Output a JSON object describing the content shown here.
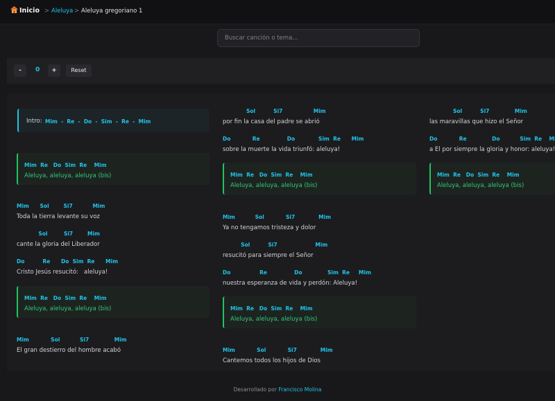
{
  "nav": {
    "home_label": "Inicio",
    "sep1": ">",
    "crumb_link": "Aleluya",
    "sep2": ">",
    "crumb_current": "Aleluya gregoriano 1"
  },
  "search": {
    "placeholder": "Buscar canción o tema..."
  },
  "controls": {
    "minus": "-",
    "value": "0",
    "plus": "+",
    "reset": "Reset"
  },
  "song": {
    "intro_label": "Intro:",
    "intro_chords": "Mim  -  Re  -  Do  -  Sim  -  Re  -  Mim",
    "chorus": {
      "chords": "Mim  Re   Do  Sim  Re    Mim",
      "lyric": "Aleluya, aleluya, aleluya (bis)"
    },
    "col1": [
      {
        "chords": "Mim      Sol        Si7           Mim",
        "lyric": "Toda la tierra levante su voz"
      },
      {
        "chords": "            Sol         Si7        Mim",
        "lyric": "cante la gloria del Liberador"
      },
      {
        "chords": "Do          Re      Do  Sim  Re      Mim",
        "lyric": "Cristo Jesús resucitó:   aleluya!"
      },
      {
        "chords": "Mim            Sol           Si7              Mim",
        "lyric": "El gran destierro del hombre acabó"
      }
    ],
    "col2": [
      {
        "chords": "             Sol          Si7                 Mim",
        "lyric": "por fin la casa del padre se abrió"
      },
      {
        "chords": "Do            Re               Do             Sim  Re      Mim",
        "lyric": "sobre la muerte la vida triunfó: aleluya!"
      },
      {
        "chords": "Mim           Sol            Si7             Mim",
        "lyric": "Ya no tengamos tristeza y dolor"
      },
      {
        "chords": "          Sol          Si7                     Mim",
        "lyric": "resucitó para siempre el Señor"
      },
      {
        "chords": "Do                Re               Do              Sim  Re     Mim",
        "lyric": "nuestra esperanza de vida y perdón: Aleluya!"
      },
      {
        "chords": "Mim            Sol            Si7             Mim",
        "lyric": "Cantemos todos los hijos de Dios"
      }
    ],
    "col3": [
      {
        "chords": "             Sol          Si7              Mim",
        "lyric": "las maravillas que hizo el Señor"
      },
      {
        "chords": "Do            Re              Do           Sim  Re    Mim",
        "lyric": "a El por siempre la gloria y honor: aleluya!"
      }
    ]
  },
  "footer": {
    "text": "Desarrollado por",
    "author": "Francisco Molina"
  }
}
